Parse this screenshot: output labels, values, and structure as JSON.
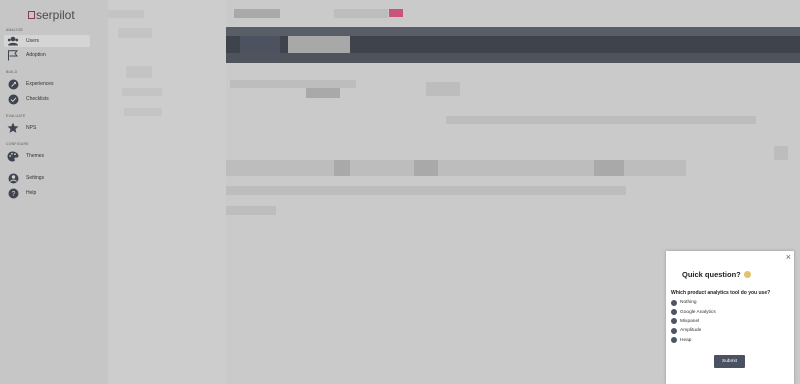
{
  "app": {
    "logo_text": "serpilot"
  },
  "sidebar": {
    "sections": [
      {
        "label": "ANALYZE"
      },
      {
        "label": "BUILD"
      },
      {
        "label": "EVALUATE"
      },
      {
        "label": "CONFIGURE"
      }
    ],
    "items": [
      {
        "label": "Users",
        "icon": "users-icon"
      },
      {
        "label": "Adoption",
        "icon": "flag-icon"
      },
      {
        "label": "Experiences",
        "icon": "rocket-icon"
      },
      {
        "label": "Checklists",
        "icon": "check-circle-icon"
      },
      {
        "label": "NPS",
        "icon": "star-icon"
      },
      {
        "label": "Themes",
        "icon": "palette-icon"
      },
      {
        "label": "Settings",
        "icon": "person-icon"
      },
      {
        "label": "Help",
        "icon": "question-icon"
      }
    ]
  },
  "survey": {
    "title": "Quick question?",
    "question": "Which product analytics tool do you use?",
    "options": [
      "Nothing",
      "Google Analytics",
      "Mixpanel",
      "Amplitude",
      "Heap"
    ],
    "submit_label": "Submit",
    "close_glyph": "×"
  },
  "colors": {
    "band": "#3e434c",
    "accent": "#c9547a",
    "radio": "#4b5563"
  }
}
